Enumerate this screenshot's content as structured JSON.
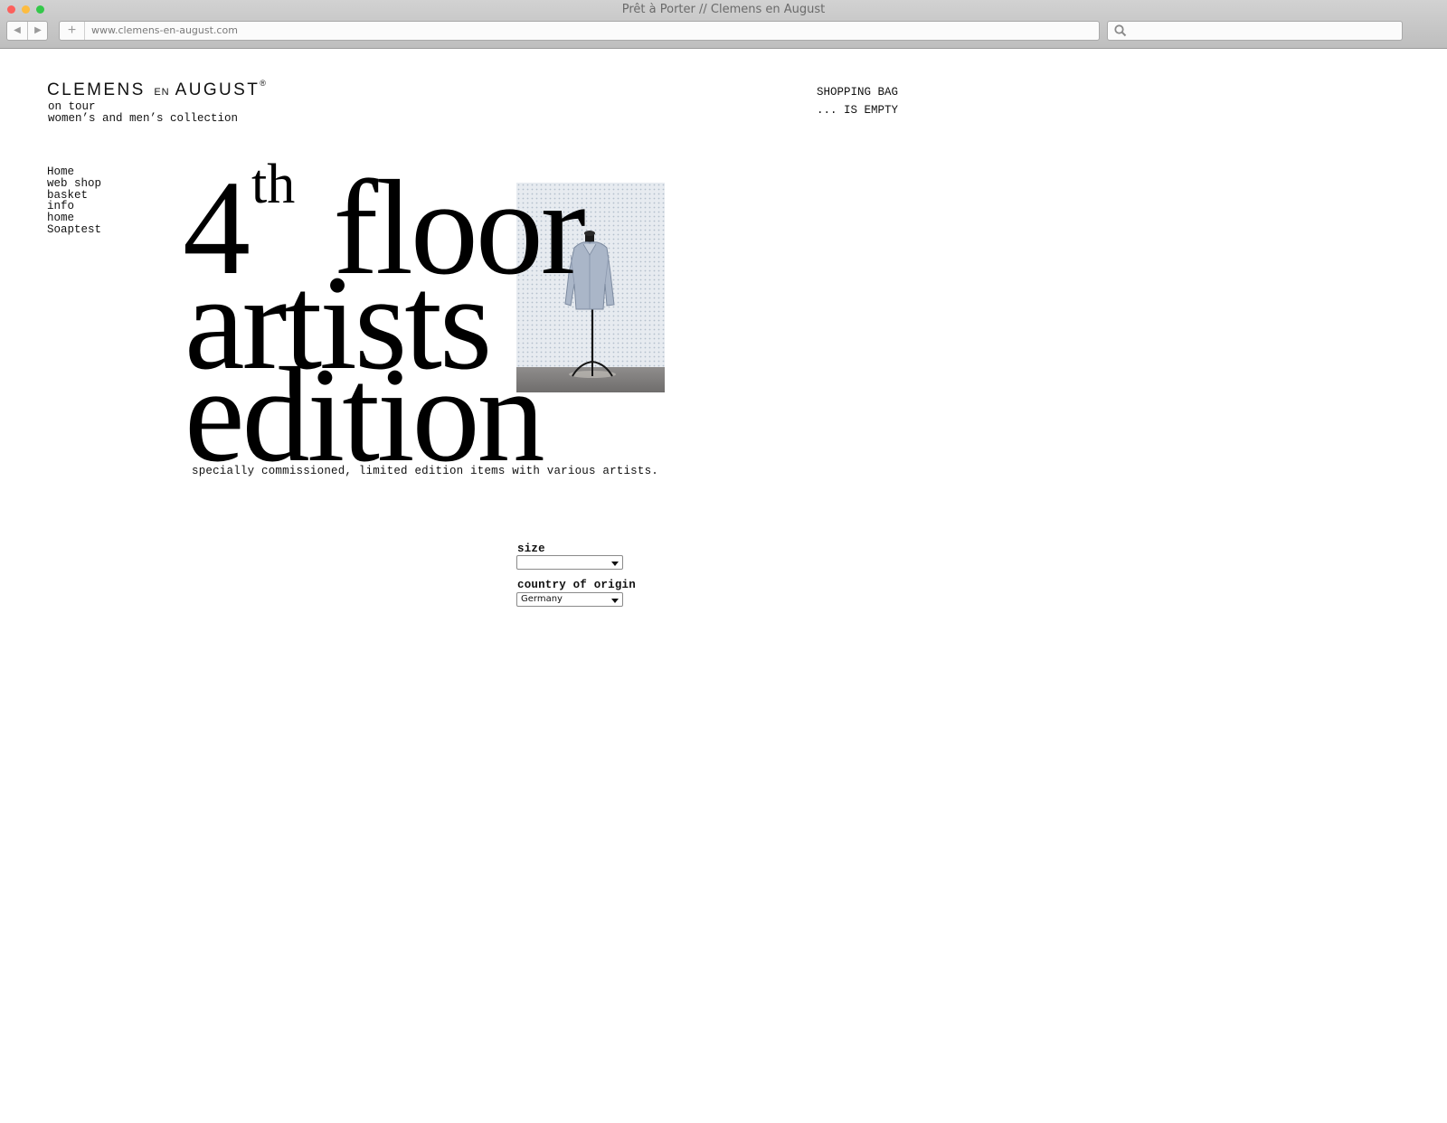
{
  "browser": {
    "window_title": "Prêt à Porter // Clemens en August",
    "url": "www.clemens-en-august.com",
    "new_tab_glyph": "+",
    "back_glyph": "◀",
    "forward_glyph": "▶"
  },
  "brand": {
    "name_part1": "CLEMENS",
    "name_part2": "EN",
    "name_part3": "AUGUST",
    "registered_mark": "®",
    "tagline_line1": "on tour",
    "tagline_line2": "women’s and men’s collection"
  },
  "cart": {
    "label": "SHOPPING BAG",
    "status": "... IS EMPTY"
  },
  "nav": {
    "items": [
      {
        "label": "Home"
      },
      {
        "label": "web shop"
      },
      {
        "label": "basket"
      },
      {
        "label": "info"
      },
      {
        "label": "home"
      },
      {
        "label": "Soaptest"
      }
    ]
  },
  "hero": {
    "number": "4",
    "ordinal": "th",
    "word1": "floor",
    "word2": "artists",
    "word3": "edition",
    "description": "specially commissioned, limited edition items with various artists."
  },
  "form": {
    "size_label": "size",
    "size_value": "",
    "country_label": "country of origin",
    "country_value": "Germany"
  },
  "icons": {
    "search": "search-icon",
    "product_image": "shirt-on-mannequin-photo"
  }
}
